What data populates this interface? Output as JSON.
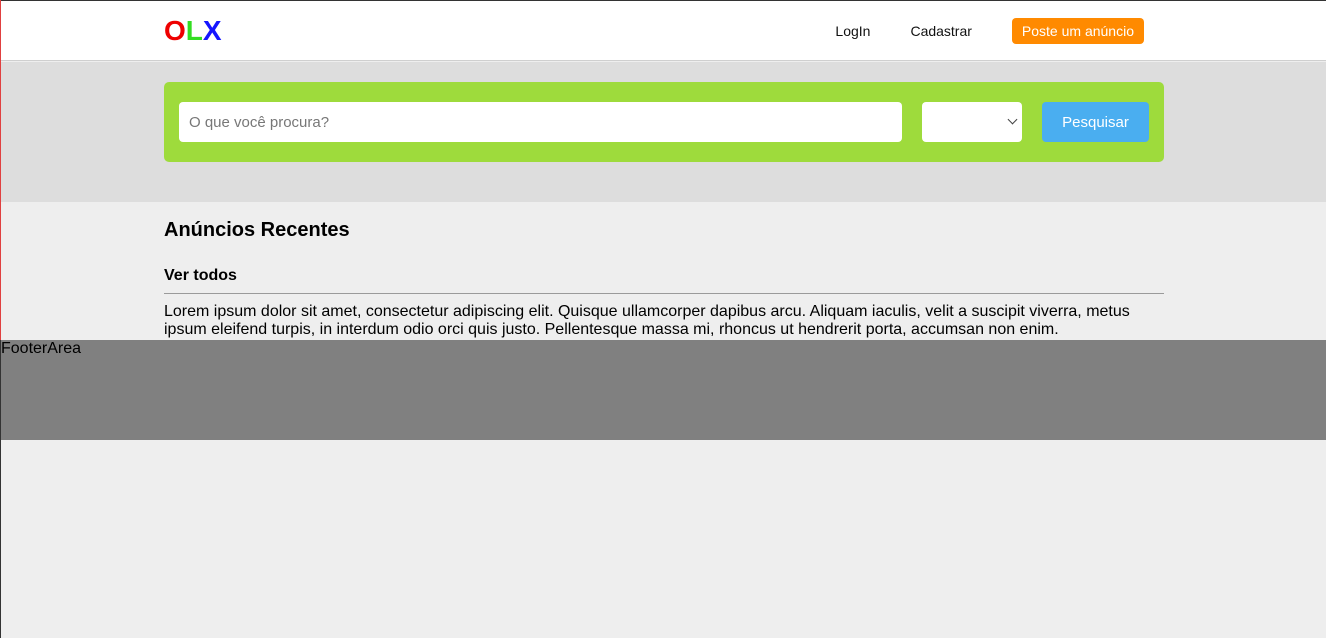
{
  "header": {
    "logo": {
      "o": "O",
      "l": "L",
      "x": "X"
    },
    "nav": {
      "login": "LogIn",
      "register": "Cadastrar",
      "post_ad": "Poste um anúncio"
    }
  },
  "search": {
    "placeholder": "O que você procura?",
    "query": "",
    "state_selected": "",
    "button_label": "Pesquisar"
  },
  "main": {
    "title": "Anúncios Recentes",
    "see_all": "Ver todos",
    "body_text": "Lorem ipsum dolor sit amet, consectetur adipiscing elit. Quisque ullamcorper dapibus arcu. Aliquam iaculis, velit a suscipit viverra, metus ipsum eleifend turpis, in interdum odio orci quis justo. Pellentesque massa mi, rhoncus ut hendrerit porta, accumsan non enim."
  },
  "footer": {
    "label": "FooterArea"
  },
  "colors": {
    "logo_o": "#ee0000",
    "logo_l": "#33dd22",
    "logo_x": "#1515ff",
    "post_button": "#ff8a00",
    "search_panel": "#9edb3c",
    "search_button": "#4aaef0",
    "footer_bg": "#808080"
  }
}
